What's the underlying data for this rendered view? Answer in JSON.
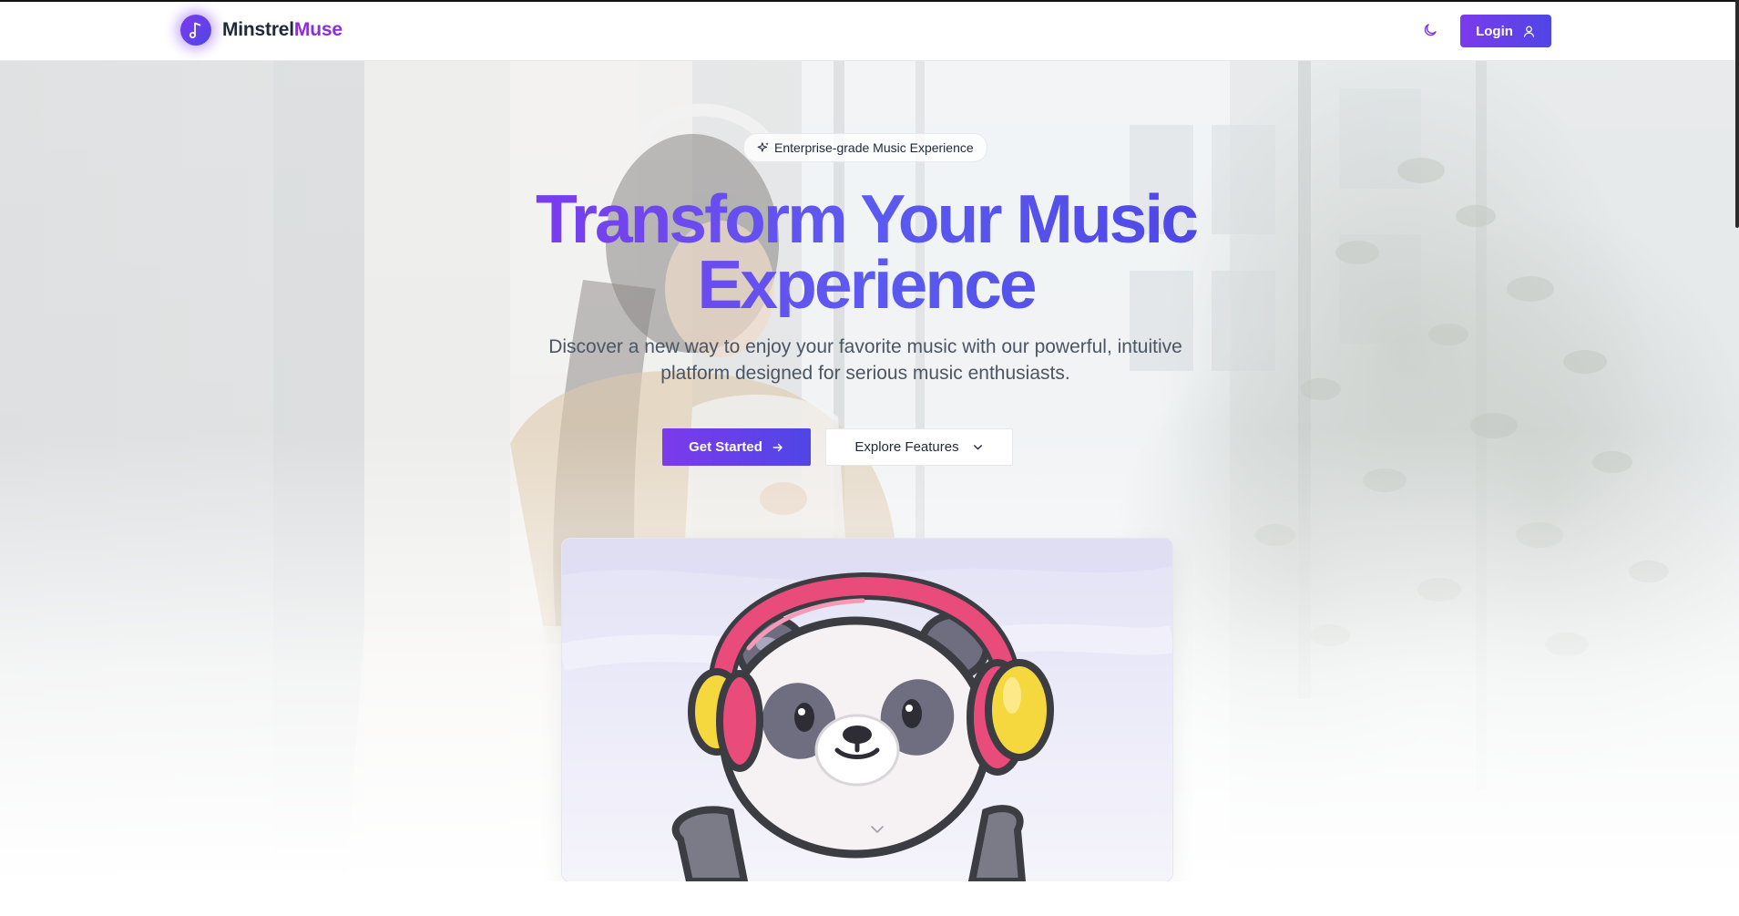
{
  "header": {
    "brand_part1": "Minstrel",
    "brand_part2": "Muse",
    "logo_icon": "music-note-icon",
    "theme_toggle_icon": "moon-icon",
    "login_label": "Login",
    "login_icon": "user-icon"
  },
  "hero": {
    "badge_icon": "sparkles-icon",
    "badge_text": "Enterprise-grade Music Experience",
    "headline": "Transform Your Music Experience",
    "subheadline": "Discover a new way to enjoy your favorite music with our powerful, intuitive platform designed for serious music enthusiasts.",
    "primary_cta": "Get Started",
    "primary_cta_icon": "arrow-right-icon",
    "secondary_cta": "Explore Features",
    "secondary_cta_icon": "chevron-down-icon",
    "scroll_hint_icon": "chevron-down-icon"
  },
  "showcase": {
    "illustration": "panda-with-headphones"
  },
  "colors": {
    "brand_start": "#7c3aed",
    "brand_end": "#4f46e5",
    "text_primary": "#1f2937",
    "text_muted": "#4b5563",
    "headphone_pink": "#e94c7a",
    "headphone_yellow": "#f5d83e"
  }
}
